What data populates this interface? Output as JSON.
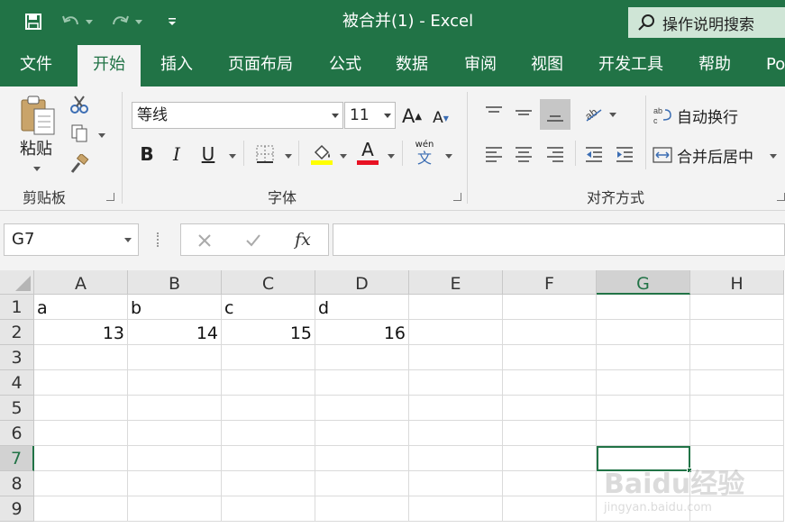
{
  "window": {
    "title": "被合并(1)  -  Excel"
  },
  "tell_me": {
    "label": "操作说明搜索"
  },
  "tabs": [
    "文件",
    "开始",
    "插入",
    "页面布局",
    "公式",
    "数据",
    "审阅",
    "视图",
    "开发工具",
    "帮助",
    "Po"
  ],
  "active_tab": "开始",
  "clipboard": {
    "paste_label": "粘贴",
    "group_label": "剪贴板"
  },
  "font": {
    "name": "等线",
    "size": "11",
    "group_label": "字体",
    "bold": "B",
    "italic": "I",
    "underline": "U",
    "grow": "A",
    "shrink": "A",
    "color_letter": "A",
    "phonetic_top": "wén",
    "phonetic_bottom": "文"
  },
  "alignment": {
    "wrap_label": "自动换行",
    "merge_label": "合并后居中",
    "group_label": "对齐方式",
    "wrap_icon_text": "ab c"
  },
  "colors": {
    "accent": "#217346",
    "highlight": "#ffff00",
    "font_color": "#e81123"
  },
  "formula_bar": {
    "name_box": "G7",
    "fx": "fx",
    "content": ""
  },
  "sheet": {
    "columns": [
      "A",
      "B",
      "C",
      "D",
      "E",
      "F",
      "G",
      "H"
    ],
    "rows": [
      "1",
      "2",
      "3",
      "4",
      "5",
      "6",
      "7",
      "8",
      "9"
    ],
    "active_cell": "G7",
    "cells": {
      "A1": "a",
      "B1": "b",
      "C1": "c",
      "D1": "d",
      "A2": "13",
      "B2": "14",
      "C2": "15",
      "D2": "16"
    }
  },
  "watermark": {
    "text": "Baidu经验",
    "url_text": "jingyan.baidu.com"
  }
}
